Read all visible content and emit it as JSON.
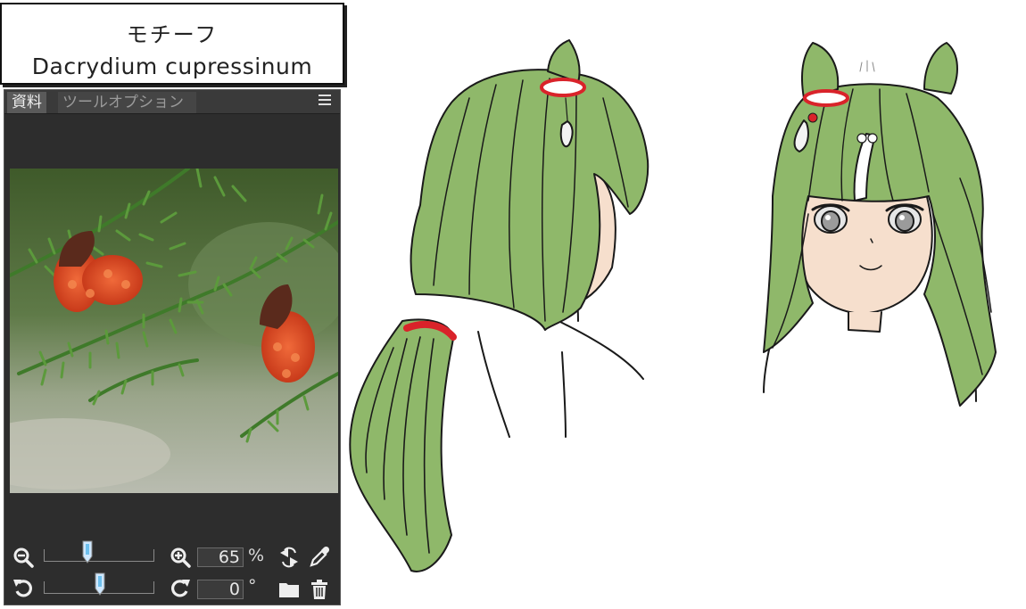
{
  "title_card": {
    "jp": "モチーフ",
    "latin": "Dacrydium cupressinum"
  },
  "panel": {
    "tabs": [
      {
        "label": "資料",
        "active": true
      },
      {
        "label": "ツールオプション",
        "active": false
      }
    ],
    "menu_icon": "hamburger-menu-icon",
    "zoom": {
      "value": "65",
      "unit": "%",
      "slider_fraction": 0.39
    },
    "rotation": {
      "value": "0",
      "unit": "°",
      "slider_fraction": 0.5
    },
    "icons": [
      "zoom-out-icon",
      "zoom-in-icon",
      "flip-icon",
      "eyedropper-icon",
      "rotate-left-icon",
      "rotate-right-icon",
      "folder-icon",
      "trash-icon"
    ]
  },
  "colors": {
    "panel_bg": "#2d2d2d",
    "hair_green": "#8fb86a",
    "skin": "#f6dfcd",
    "ribbon_red": "#d9232a"
  }
}
